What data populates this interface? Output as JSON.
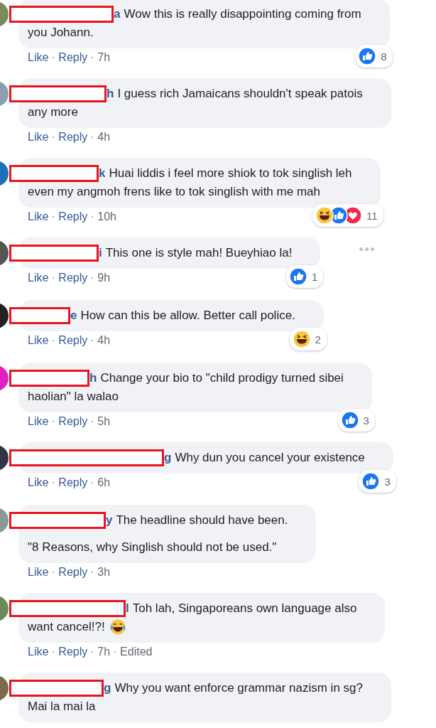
{
  "comments": [
    {
      "name": "a",
      "lines": [
        "Wow this is really disappointing coming from",
        "you Johann."
      ],
      "actions": [
        "Like",
        "Reply"
      ],
      "time": "7h",
      "reactions": {
        "icons": [
          {
            "kind": "like"
          }
        ],
        "count": "8"
      }
    },
    {
      "name": "h",
      "lines": [
        "I guess rich Jamaicans shouldn't speak patois",
        "any more"
      ],
      "actions": [
        "Like",
        "Reply"
      ],
      "time": "4h"
    },
    {
      "name": "k",
      "lines": [
        "Huai liddis i feel more shiok to tok singlish leh",
        "even my angmoh frens like to tok singlish with me mah"
      ],
      "actions": [
        "Like",
        "Reply"
      ],
      "time": "10h",
      "reactions": {
        "icons": [
          {
            "kind": "haha"
          },
          {
            "kind": "like"
          },
          {
            "kind": "love"
          }
        ],
        "count": "11"
      }
    },
    {
      "name": "i",
      "lines": [
        "This one is style mah! Bueyhiao la!"
      ],
      "actions": [
        "Like",
        "Reply"
      ],
      "time": "9h",
      "reactions": {
        "icons": [
          {
            "kind": "like"
          }
        ],
        "count": "1"
      },
      "more_menu": true
    },
    {
      "name": "e",
      "lines": [
        "How can this be allow. Better call police."
      ],
      "actions": [
        "Like",
        "Reply"
      ],
      "time": "4h",
      "reactions": {
        "icons": [
          {
            "kind": "haha"
          }
        ],
        "count": "2"
      }
    },
    {
      "name": "h",
      "lines": [
        "Change your bio to \"child prodigy turned sibei",
        "haolian\" la walao"
      ],
      "actions": [
        "Like",
        "Reply"
      ],
      "time": "5h",
      "reactions": {
        "icons": [
          {
            "kind": "like"
          }
        ],
        "count": "3"
      }
    },
    {
      "name": "g",
      "lines": [
        "Why dun you cancel your existence"
      ],
      "actions": [
        "Like",
        "Reply"
      ],
      "time": "6h",
      "reactions": {
        "icons": [
          {
            "kind": "like"
          }
        ],
        "count": "3"
      }
    },
    {
      "name": "y",
      "lines": [
        "The headline should have been.",
        "\"8 Reasons, why Singlish should not be used.\""
      ],
      "actions": [
        "Like",
        "Reply"
      ],
      "time": "3h"
    },
    {
      "name": "l",
      "lines": [
        "Toh lah, Singaporeans own language also",
        "want cancel!?!"
      ],
      "trailing_emoji": true,
      "actions": [
        "Like",
        "Reply"
      ],
      "time": "7h",
      "edited": "Edited"
    },
    {
      "name": "g",
      "lines": [
        "Why you want enforce grammar nazism in sg?",
        "Mai la mai la"
      ]
    }
  ]
}
